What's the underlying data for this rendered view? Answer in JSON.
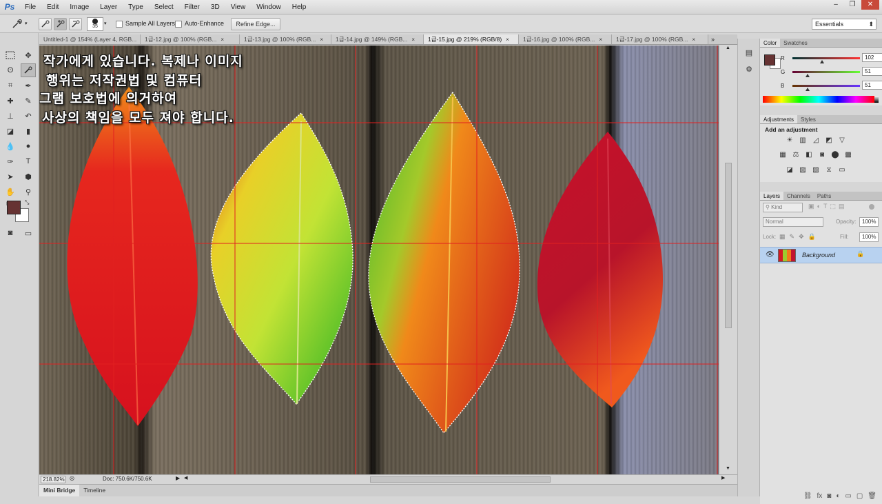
{
  "app": {
    "logo": "Ps",
    "menu": [
      "File",
      "Edit",
      "Image",
      "Layer",
      "Type",
      "Select",
      "Filter",
      "3D",
      "View",
      "Window",
      "Help"
    ],
    "window_controls": [
      "–",
      "❐",
      "✕"
    ]
  },
  "options_bar": {
    "brush_size": "35",
    "sample_all_layers": "Sample All Layers",
    "auto_enhance": "Auto-Enhance",
    "refine_edge": "Refine Edge...",
    "workspace": "Essentials"
  },
  "doc_tabs": [
    {
      "label": "Untitled-1 @ 154% (Layer 4, RGB...",
      "close": "×"
    },
    {
      "label": "1급-12.jpg @ 100% (RGB...",
      "close": "×"
    },
    {
      "label": "1급-13.jpg @ 100% (RGB...",
      "close": "×"
    },
    {
      "label": "1급-14.jpg @ 149% (RGB...",
      "close": "×"
    },
    {
      "label": "1급-15.jpg @ 219% (RGB/8)",
      "close": "×"
    },
    {
      "label": "1급-16.jpg @ 100% (RGB...",
      "close": "×"
    },
    {
      "label": "1급-17.jpg @ 100% (RGB...",
      "close": "×"
    }
  ],
  "overlay_text": [
    "작가에게 있습니다. 복제나 이미지",
    "행위는 저작권법 및 컴퓨터",
    "그램 보호법에 의거하여",
    "사상의 책임을 모두 져야 합니다."
  ],
  "status": {
    "zoom": "218.82%",
    "doc": "Doc: 750.6K/750.6K"
  },
  "bottom_tabs": [
    "Mini Bridge",
    "Timeline"
  ],
  "color_panel": {
    "tabs": [
      "Color",
      "Swatches"
    ],
    "R": {
      "label": "R",
      "value": "102"
    },
    "G": {
      "label": "G",
      "value": "51"
    },
    "B": {
      "label": "B",
      "value": "51"
    },
    "foreground": "#663333",
    "background": "#ffffff"
  },
  "adjustments_panel": {
    "tabs": [
      "Adjustments",
      "Styles"
    ],
    "heading": "Add an adjustment"
  },
  "layers_panel": {
    "tabs": [
      "Layers",
      "Channels",
      "Paths"
    ],
    "kind_placeholder": "Kind",
    "blend_mode": "Normal",
    "opacity_label": "Opacity:",
    "opacity_value": "100%",
    "lock_label": "Lock:",
    "fill_label": "Fill:",
    "fill_value": "100%",
    "layers": [
      {
        "name": "Background"
      }
    ]
  }
}
